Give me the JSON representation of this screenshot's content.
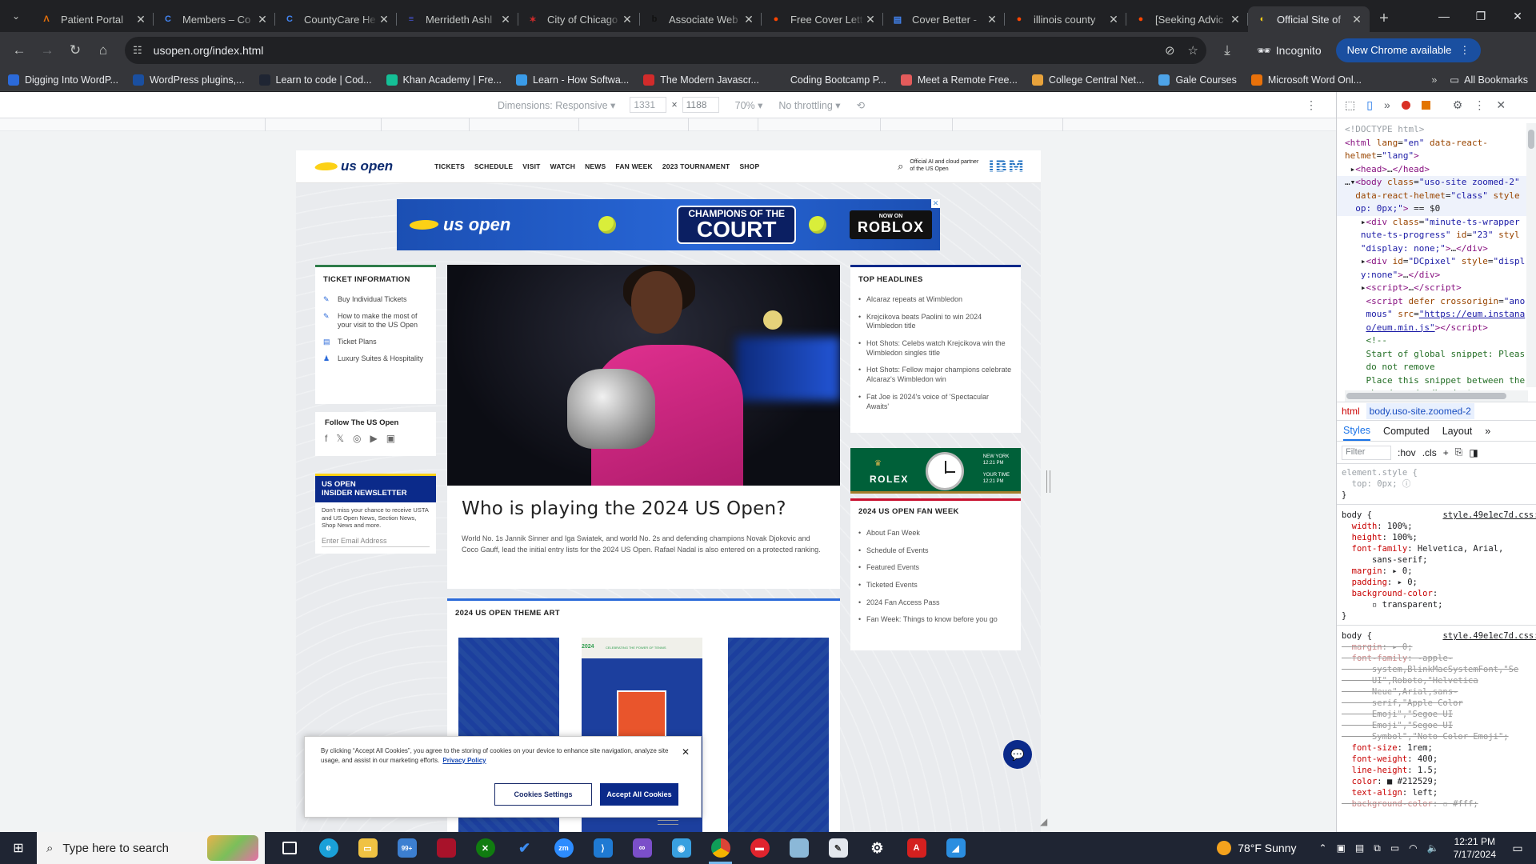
{
  "browser": {
    "tabs": [
      {
        "title": "Patient Portal",
        "fav_color": "#e8710a",
        "fav_glyph": "Λ"
      },
      {
        "title": "Members – Co",
        "fav_color": "#4285f4",
        "fav_glyph": "C"
      },
      {
        "title": "CountyCare He",
        "fav_color": "#4285f4",
        "fav_glyph": "C"
      },
      {
        "title": "Merrideth Ashl",
        "fav_color": "#4755d6",
        "fav_glyph": "≡"
      },
      {
        "title": "City of Chicago",
        "fav_color": "#d12b2b",
        "fav_glyph": "✶"
      },
      {
        "title": "Associate Web",
        "fav_color": "#111111",
        "fav_glyph": "b"
      },
      {
        "title": "Free Cover Lett",
        "fav_color": "#ff4500",
        "fav_glyph": "●"
      },
      {
        "title": "Cover Better -",
        "fav_color": "#4285f4",
        "fav_glyph": "▤"
      },
      {
        "title": "illinois county",
        "fav_color": "#ff4500",
        "fav_glyph": "●"
      },
      {
        "title": "[Seeking Advic",
        "fav_color": "#ff4500",
        "fav_glyph": "●"
      },
      {
        "title": "Official Site of",
        "fav_color": "#fcd116",
        "fav_glyph": "◐"
      }
    ],
    "active_tab": 10,
    "url": "usopen.org/index.html",
    "incognito_label": "Incognito",
    "new_chrome_label": "New Chrome available",
    "bookmarks": [
      {
        "label": "Digging Into WordP...",
        "color": "#2b6ad9"
      },
      {
        "label": "WordPress plugins,...",
        "color": "#1a4fa0"
      },
      {
        "label": "Learn to code | Cod...",
        "color": "#1f2533"
      },
      {
        "label": "Khan Academy | Fre...",
        "color": "#14bf96"
      },
      {
        "label": "Learn - How Softwa...",
        "color": "#3a9be8"
      },
      {
        "label": "The Modern Javascr...",
        "color": "#d12b2b"
      },
      {
        "label": "Coding Bootcamp P...",
        "color": "#35363a"
      },
      {
        "label": "Meet a Remote Free...",
        "color": "#e35b5b"
      },
      {
        "label": "College Central Net...",
        "color": "#e8a23b"
      },
      {
        "label": "Gale Courses",
        "color": "#4da3e8"
      },
      {
        "label": "Microsoft Word Onl...",
        "color": "#e8710a"
      }
    ],
    "all_bookmarks_label": "All Bookmarks"
  },
  "device_toolbar": {
    "dimensions_label": "Dimensions: Responsive",
    "width": "1331",
    "height": "1188",
    "zoom": "70%",
    "throttle": "No throttling"
  },
  "site": {
    "logo_text": "us open",
    "nav": [
      "TICKETS",
      "SCHEDULE",
      "VISIT",
      "WATCH",
      "NEWS",
      "FAN WEEK",
      "2023 TOURNAMENT",
      "SHOP"
    ],
    "partner_text": "Official AI and cloud partner of the US Open",
    "ibm": "IBM",
    "banner": {
      "logo": "us open",
      "champ_line1": "CHAMPIONS OF THE",
      "champ_line2": "COURT",
      "now_on": "NOW ON",
      "roblox": "ROBLOX"
    },
    "ticket_info": {
      "heading": "TICKET INFORMATION",
      "items": [
        "Buy Individual Tickets",
        "How to make the most of your visit to the US Open",
        "Ticket Plans",
        "Luxury Suites & Hospitality"
      ]
    },
    "follow": {
      "heading": "Follow The US Open",
      "icons": [
        "facebook-icon",
        "x-icon",
        "instagram-icon",
        "youtube-icon",
        "app-icon"
      ]
    },
    "newsletter": {
      "heading_line1": "US OPEN",
      "heading_line2": "INSIDER NEWSLETTER",
      "desc": "Don't miss your chance to receive USTA and US Open News, Section News, Shop News and more.",
      "placeholder": "Enter Email Address"
    },
    "hero": {
      "title": "Who is playing the 2024 US Open?",
      "desc": "World No. 1s Jannik Sinner and Iga Swiatek, and world No. 2s and defending champions Novak Djokovic and Coco Gauff, lead the initial entry lists for the 2024 US Open. Rafael Nadal is also entered on a protected ranking."
    },
    "theme_art": {
      "heading": "2024 US OPEN THEME ART",
      "year": "2024",
      "tagline": "CELEBRATING THE POWER OF TENNIS"
    },
    "top_headlines": {
      "heading": "TOP HEADLINES",
      "items": [
        "Alcaraz repeats at Wimbledon",
        "Krejcikova beats Paolini to win 2024 Wimbledon title",
        "Hot Shots: Celebs watch Krejcikova win the Wimbledon singles title",
        "Hot Shots: Fellow major champions celebrate Alcaraz's Wimbledon win",
        "Fat Joe is 2024's voice of 'Spectacular Awaits'"
      ]
    },
    "rolex": {
      "brand": "ROLEX",
      "city": "NEW YORK",
      "time": "12:21 PM",
      "your_time_label": "YOUR TIME",
      "your_time": "12:21 PM"
    },
    "fan_week": {
      "heading": "2024 US OPEN FAN WEEK",
      "items": [
        "About Fan Week",
        "Schedule of Events",
        "Featured Events",
        "Ticketed Events",
        "2024 Fan Access Pass",
        "Fan Week: Things to know before you go"
      ]
    },
    "cookie": {
      "text": "By clicking “Accept All Cookies”, you agree to the storing of cookies on your device to enhance site navigation, analyze site usage, and assist in our marketing efforts.",
      "policy_link": "Privacy Policy",
      "settings_label": "Cookies Settings",
      "accept_label": "Accept All Cookies"
    }
  },
  "devtools": {
    "crumb_html": "html",
    "crumb_body": "body.uso-site.zoomed-2",
    "tabs": [
      "Styles",
      "Computed",
      "Layout"
    ],
    "filter_placeholder": "Filter",
    "hov": ":hov",
    "cls": ".cls"
  },
  "taskbar": {
    "search_placeholder": "Type here to search",
    "weather": "78°F  Sunny",
    "time": "12:21 PM",
    "date": "7/17/2024",
    "badge": "99+"
  }
}
